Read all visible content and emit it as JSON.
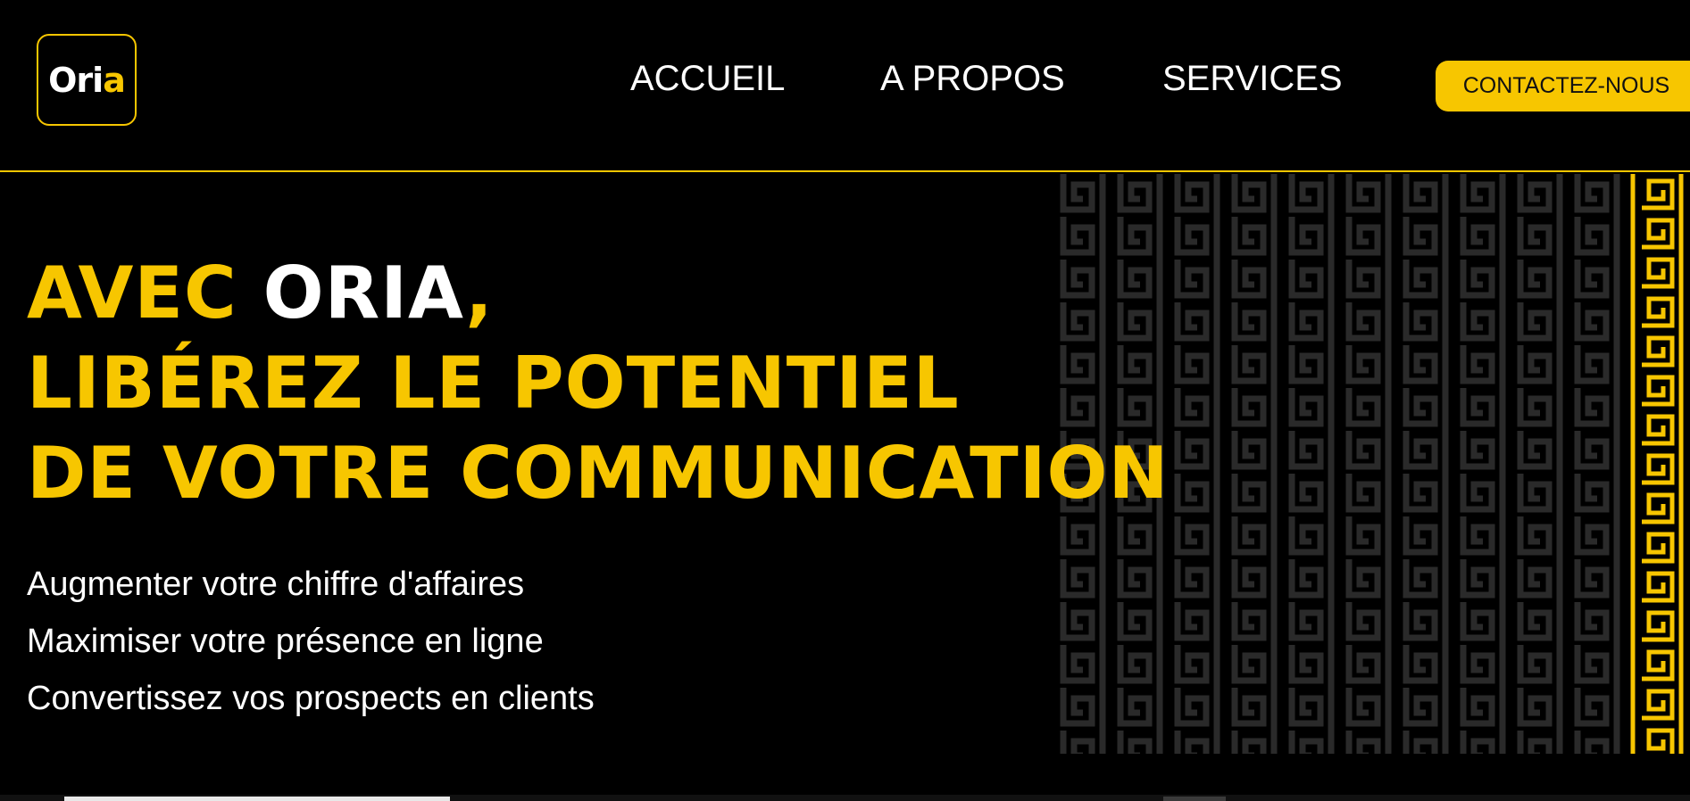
{
  "brand": {
    "logo_text_main": "Or",
    "logo_text_i": "i",
    "logo_text_end": "a",
    "accent_color": "#f7c600"
  },
  "nav": {
    "items": [
      {
        "label": "ACCUEIL"
      },
      {
        "label": "A PROPOS"
      },
      {
        "label": "SERVICES"
      }
    ],
    "cta_label": "CONTACTEZ-NOUS"
  },
  "hero": {
    "headline_line1_prefix": "AVEC ",
    "headline_brand": "ORIA",
    "headline_line1_suffix": ",",
    "headline_line2": "LIBÉREZ LE POTENTIEL",
    "headline_line3": "DE VOTRE COMMUNICATION",
    "bullets": [
      "Augmenter votre chiffre d'affaires",
      "Maximiser votre présence en ligne",
      "Convertissez vos prospects en clients"
    ],
    "pattern_icon": "greek-key-pattern"
  }
}
